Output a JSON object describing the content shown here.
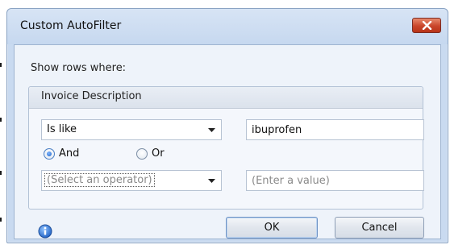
{
  "window": {
    "title": "Custom AutoFilter",
    "close_icon": "close-icon"
  },
  "dialog": {
    "prompt": "Show rows where:",
    "group_title": "Invoice Description",
    "condition1": {
      "operator": "Is like",
      "value": "ibuprofen"
    },
    "logic": {
      "and_label": "And",
      "or_label": "Or",
      "selected": "And"
    },
    "condition2": {
      "operator_placeholder": "(Select an operator)",
      "value_placeholder": "(Enter a value)"
    },
    "info_icon": "info-icon",
    "ok_label": "OK",
    "cancel_label": "Cancel"
  }
}
